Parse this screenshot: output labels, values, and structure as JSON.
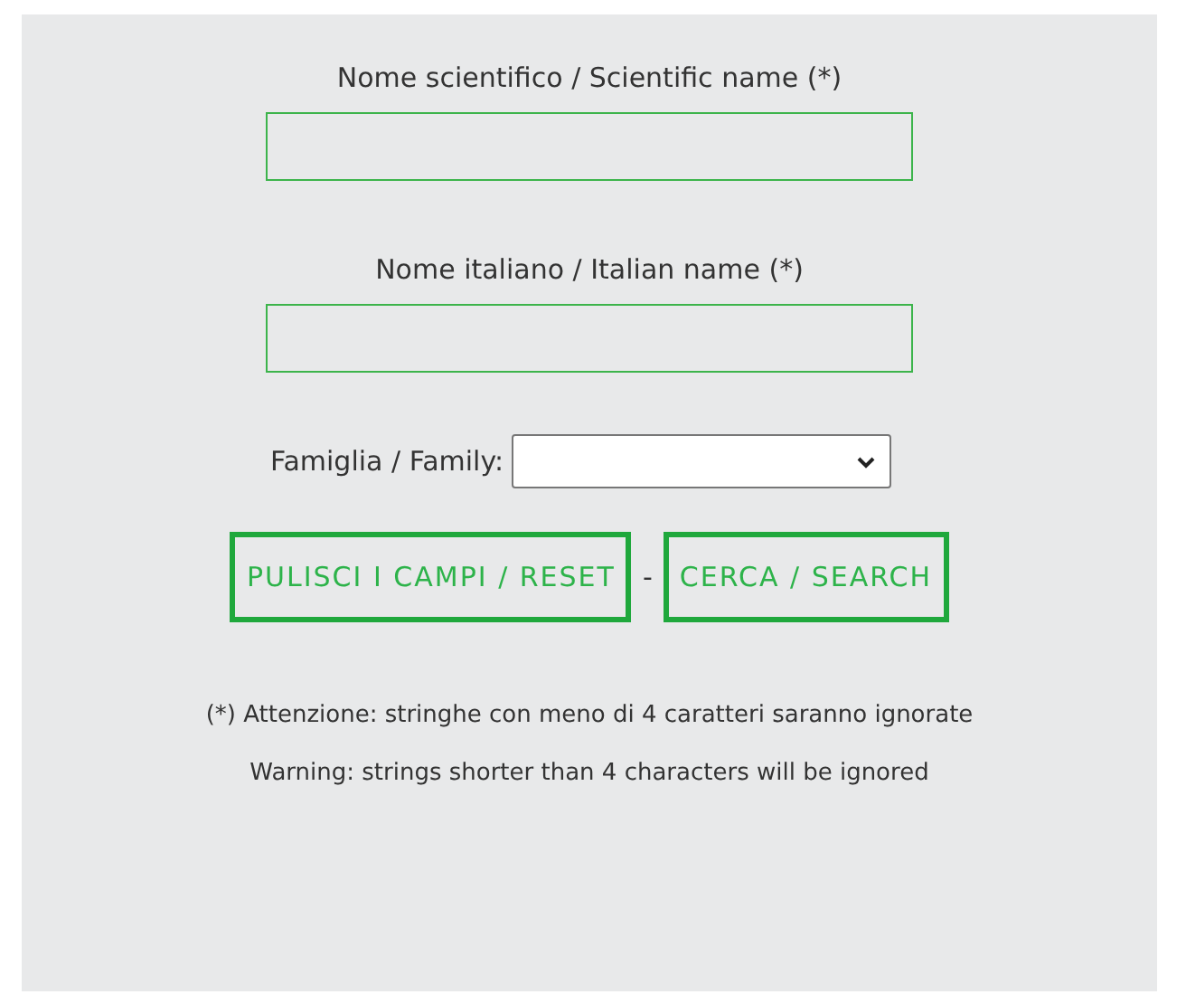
{
  "fields": [
    {
      "label": "Nome scientifico / Scientific name (*)"
    },
    {
      "label": "Nome italiano / Italian name (*)"
    }
  ],
  "family": {
    "label": "Famiglia / Family:"
  },
  "buttons": [
    {
      "label": "PULISCI I CAMPI / RESET"
    },
    {
      "label": "CERCA / SEARCH"
    }
  ],
  "separator": "-",
  "notes": [
    "(*) Attenzione: stringhe con meno di 4 caratteri saranno ignorate",
    "Warning: strings shorter than 4 characters will be ignored"
  ]
}
